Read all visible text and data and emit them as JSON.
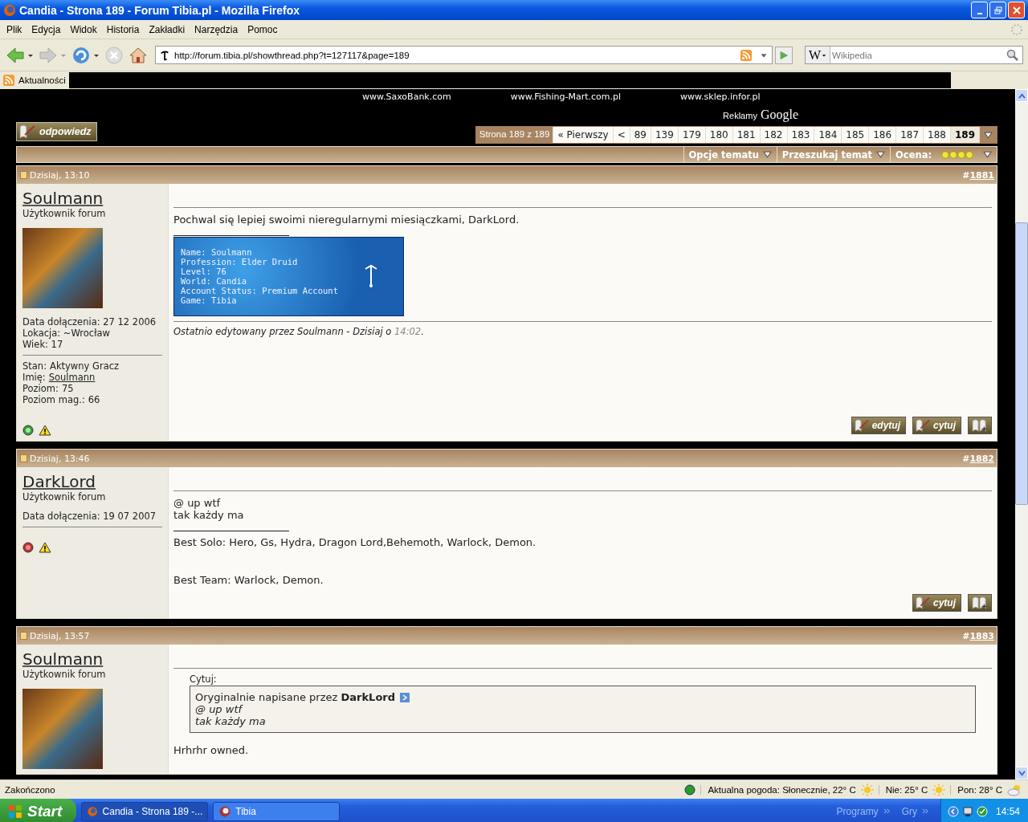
{
  "window": {
    "title": "Candia - Strona 189 - Forum Tibia.pl - Mozilla Firefox"
  },
  "menu": [
    "Plik",
    "Edycja",
    "Widok",
    "Historia",
    "Zakładki",
    "Narzędzia",
    "Pomoc"
  ],
  "toolbar": {
    "url": "http://forum.tibia.pl/showthread.php?t=127117&page=189",
    "search_engine": "W",
    "search_placeholder": "Wikipedia"
  },
  "bookmarks": [
    {
      "label": "Aktualności"
    }
  ],
  "ads": {
    "links": [
      "www.SaxoBank.com",
      "www.Fishing-Mart.com.pl",
      "www.sklep.infor.pl"
    ],
    "label": "Reklamy",
    "brand": "Google"
  },
  "reply_button": "odpowiedz",
  "pagination": {
    "label": "Strona 189 z 189",
    "first": "« Pierwszy",
    "prev": "<",
    "pages": [
      {
        "label": "89",
        "selected": false
      },
      {
        "label": "139",
        "selected": false
      },
      {
        "label": "179",
        "selected": false
      },
      {
        "label": "180",
        "selected": false
      },
      {
        "label": "181",
        "selected": false
      },
      {
        "label": "182",
        "selected": false
      },
      {
        "label": "183",
        "selected": false
      },
      {
        "label": "184",
        "selected": false
      },
      {
        "label": "185",
        "selected": false
      },
      {
        "label": "186",
        "selected": false
      },
      {
        "label": "187",
        "selected": false
      },
      {
        "label": "188",
        "selected": false
      },
      {
        "label": "189",
        "selected": true
      }
    ]
  },
  "thread_tools": {
    "options": "Opcje tematu",
    "search": "Przeszukaj temat",
    "rating_label": "Ocena:",
    "stars": 4
  },
  "posts": [
    {
      "date": "Dzisiaj, 13:10",
      "mark": "#",
      "number": "1881",
      "author": {
        "name": "Soulmann",
        "title": "Użytkownik forum",
        "avatar": true,
        "info": [
          "Data dołączenia: 27 12 2006",
          "Lokacja: ~Wrocław",
          "Wiek: 17"
        ],
        "profile": [
          {
            "label": "Stan:",
            "value": "Aktywny Gracz"
          },
          {
            "label": "Imię:",
            "value": "Soulmann",
            "link": true
          },
          {
            "label": "Poziom:",
            "value": "75"
          },
          {
            "label": "Poziom mag.:",
            "value": "66"
          }
        ],
        "online": true
      },
      "message": [
        "Pochwal się lepiej swoimi nieregularnymi miesiączkami, DarkLord."
      ],
      "signature": {
        "kind": "banner",
        "lines": [
          "Name: Soulmann",
          "Profession: Elder Druid",
          "Level: 76",
          "World: Candia",
          "Account Status: Premium Account",
          "Game: Tibia"
        ]
      },
      "edited": {
        "text": "Ostatnio edytowany przez Soulmann - Dzisiaj o",
        "time": "14:02",
        "end": "."
      },
      "buttons": [
        {
          "kind": "edit",
          "label": "edytuj"
        },
        {
          "kind": "quote",
          "label": "cytuj"
        },
        {
          "kind": "multiquote"
        }
      ]
    },
    {
      "date": "Dzisiaj, 13:46",
      "mark": "#",
      "number": "1882",
      "author": {
        "name": "DarkLord",
        "title": "Użytkownik forum",
        "info": [
          "Data dołączenia: 19 07 2007"
        ],
        "online": false
      },
      "message": [
        "@ up wtf",
        "tak każdy ma"
      ],
      "signature": {
        "kind": "text",
        "lines": [
          "Best Solo: Hero, Gs, Hydra, Dragon Lord,Behemoth, Warlock, Demon.",
          "Best Team: Warlock, Demon."
        ]
      },
      "buttons": [
        {
          "kind": "quote",
          "label": "cytuj"
        },
        {
          "kind": "multiquote"
        }
      ]
    },
    {
      "date": "Dzisiaj, 13:57",
      "mark": "#",
      "number": "1883",
      "author": {
        "name": "Soulmann",
        "title": "Użytkownik forum",
        "avatar": true
      },
      "quote": {
        "label": "Cytuj:",
        "intro": "Oryginalnie napisane przez **DarkLord**",
        "lines": [
          "@ up wtf",
          "tak każdy ma"
        ]
      },
      "message": [
        "Hrhrhr owned."
      ]
    }
  ],
  "status_bar": {
    "text": "Zakończono",
    "weather": [
      "Aktualna pogoda: Słonecznie, 22° C",
      "Nie: 25° C",
      "Pon: 28° C"
    ]
  },
  "taskbar": {
    "start": "Start",
    "tasks": [
      {
        "label": "Candia - Strona 189 -...",
        "selected": true
      },
      {
        "label": "Tibia",
        "selected": false
      }
    ],
    "toolbars": [
      "Programy",
      "Gry"
    ],
    "clock": "14:54"
  }
}
